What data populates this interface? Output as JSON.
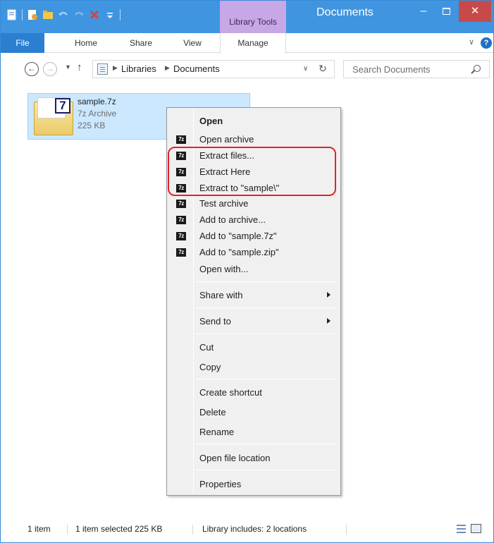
{
  "titlebar": {
    "contextual_tab_group": "Library Tools",
    "window_title": "Documents",
    "minimize": "–",
    "close": "✕"
  },
  "ribbon": {
    "tabs": {
      "file": "File",
      "home": "Home",
      "share": "Share",
      "view": "View",
      "manage": "Manage"
    },
    "help_label": "?"
  },
  "navigation": {
    "breadcrumb": [
      "Libraries",
      "Documents"
    ],
    "search_placeholder": "Search Documents"
  },
  "file": {
    "name": "sample.7z",
    "type": "7z Archive",
    "size": "225 KB",
    "badge": "7"
  },
  "context_menu": {
    "items": [
      {
        "label": "Open",
        "bold": true,
        "icon": null
      },
      {
        "label": "Open archive",
        "icon": "7z-icon"
      },
      {
        "label": "Extract files...",
        "icon": "7z-icon"
      },
      {
        "label": "Extract Here",
        "icon": "7z-icon"
      },
      {
        "label": "Extract to \"sample\\\"",
        "icon": "7z-icon"
      },
      {
        "label": "Test archive",
        "icon": "7z-icon"
      },
      {
        "label": "Add to archive...",
        "icon": "7z-icon"
      },
      {
        "label": "Add to \"sample.7z\"",
        "icon": "7z-icon"
      },
      {
        "label": "Add to \"sample.zip\"",
        "icon": "7z-icon"
      },
      {
        "label": "Open with...",
        "icon": null
      },
      {
        "label": "Share with",
        "submenu": true
      },
      {
        "label": "Send to",
        "submenu": true
      },
      {
        "label": "Cut"
      },
      {
        "label": "Copy"
      },
      {
        "label": "Create shortcut"
      },
      {
        "label": "Delete"
      },
      {
        "label": "Rename"
      },
      {
        "label": "Open file location"
      },
      {
        "label": "Properties"
      }
    ],
    "icon_text": "7z",
    "highlight_color": "#e0232b"
  },
  "statusbar": {
    "item_count": "1 item",
    "selection": "1 item selected  225 KB",
    "library_info": "Library includes: 2 locations"
  }
}
